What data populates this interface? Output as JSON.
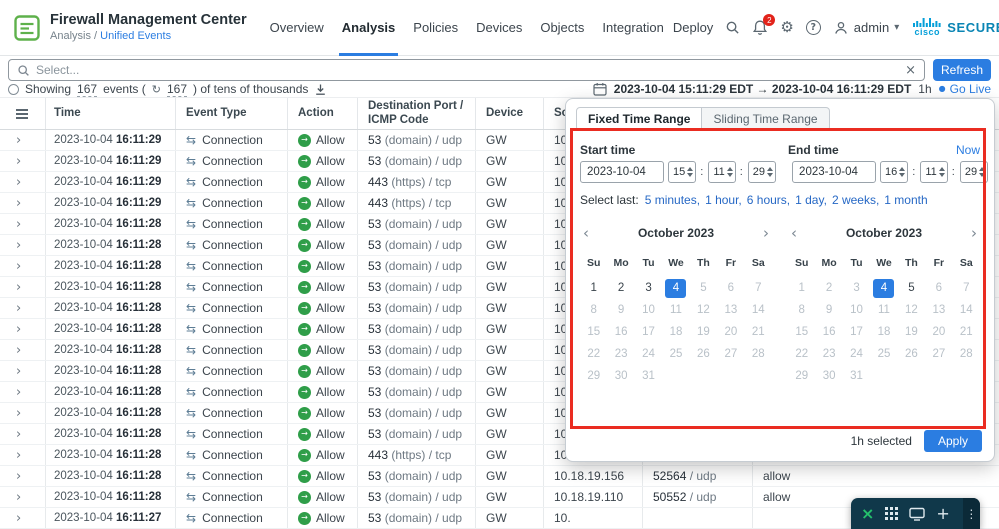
{
  "header": {
    "product": "Firewall Management Center",
    "breadcrumb": {
      "section": "Analysis /",
      "page": "Unified Events"
    },
    "nav": [
      {
        "label": "Overview",
        "active": false
      },
      {
        "label": "Analysis",
        "active": true
      },
      {
        "label": "Policies",
        "active": false
      },
      {
        "label": "Devices",
        "active": false
      },
      {
        "label": "Objects",
        "active": false
      },
      {
        "label": "Integration",
        "active": false
      }
    ],
    "deploy": "Deploy",
    "badge_count": "2",
    "user": "admin",
    "brand": {
      "cisco": "cisco",
      "secure": "SECURE"
    }
  },
  "filter": {
    "placeholder": "Select...",
    "refresh": "Refresh"
  },
  "status": {
    "prefix": "Showing",
    "total": "167",
    "mid": "events (",
    "refreshed": "167",
    "suffix": ") of tens of thousands",
    "range": "2023-10-04 15:11:29 EDT → 2023-10-04 16:11:29 EDT",
    "duration": "1h",
    "go_live": "Go Live"
  },
  "table": {
    "columns": [
      "Time",
      "Event Type",
      "Action",
      "Destination Port / ICMP Code",
      "Device",
      "Source",
      "",
      ""
    ],
    "rows": [
      {
        "date": "2023-10-04",
        "time": "16:11:29",
        "type": "Connection",
        "action": "Allow",
        "dest": "53 (domain) / udp",
        "device": "GW",
        "source": "10.",
        "sport": "",
        "rule": ""
      },
      {
        "date": "2023-10-04",
        "time": "16:11:29",
        "type": "Connection",
        "action": "Allow",
        "dest": "53 (domain) / udp",
        "device": "GW",
        "source": "10.",
        "sport": "",
        "rule": ""
      },
      {
        "date": "2023-10-04",
        "time": "16:11:29",
        "type": "Connection",
        "action": "Allow",
        "dest": "443 (https) / tcp",
        "device": "GW",
        "source": "10.",
        "sport": "",
        "rule": ""
      },
      {
        "date": "2023-10-04",
        "time": "16:11:29",
        "type": "Connection",
        "action": "Allow",
        "dest": "443 (https) / tcp",
        "device": "GW",
        "source": "10.",
        "sport": "",
        "rule": ""
      },
      {
        "date": "2023-10-04",
        "time": "16:11:28",
        "type": "Connection",
        "action": "Allow",
        "dest": "53 (domain) / udp",
        "device": "GW",
        "source": "10.",
        "sport": "",
        "rule": ""
      },
      {
        "date": "2023-10-04",
        "time": "16:11:28",
        "type": "Connection",
        "action": "Allow",
        "dest": "53 (domain) / udp",
        "device": "GW",
        "source": "10.",
        "sport": "",
        "rule": ""
      },
      {
        "date": "2023-10-04",
        "time": "16:11:28",
        "type": "Connection",
        "action": "Allow",
        "dest": "53 (domain) / udp",
        "device": "GW",
        "source": "10.",
        "sport": "",
        "rule": ""
      },
      {
        "date": "2023-10-04",
        "time": "16:11:28",
        "type": "Connection",
        "action": "Allow",
        "dest": "53 (domain) / udp",
        "device": "GW",
        "source": "10.",
        "sport": "",
        "rule": ""
      },
      {
        "date": "2023-10-04",
        "time": "16:11:28",
        "type": "Connection",
        "action": "Allow",
        "dest": "53 (domain) / udp",
        "device": "GW",
        "source": "10.",
        "sport": "",
        "rule": ""
      },
      {
        "date": "2023-10-04",
        "time": "16:11:28",
        "type": "Connection",
        "action": "Allow",
        "dest": "53 (domain) / udp",
        "device": "GW",
        "source": "10.",
        "sport": "",
        "rule": ""
      },
      {
        "date": "2023-10-04",
        "time": "16:11:28",
        "type": "Connection",
        "action": "Allow",
        "dest": "53 (domain) / udp",
        "device": "GW",
        "source": "10.",
        "sport": "",
        "rule": ""
      },
      {
        "date": "2023-10-04",
        "time": "16:11:28",
        "type": "Connection",
        "action": "Allow",
        "dest": "53 (domain) / udp",
        "device": "GW",
        "source": "10.",
        "sport": "",
        "rule": ""
      },
      {
        "date": "2023-10-04",
        "time": "16:11:28",
        "type": "Connection",
        "action": "Allow",
        "dest": "53 (domain) / udp",
        "device": "GW",
        "source": "10.",
        "sport": "",
        "rule": ""
      },
      {
        "date": "2023-10-04",
        "time": "16:11:28",
        "type": "Connection",
        "action": "Allow",
        "dest": "53 (domain) / udp",
        "device": "GW",
        "source": "10.",
        "sport": "",
        "rule": ""
      },
      {
        "date": "2023-10-04",
        "time": "16:11:28",
        "type": "Connection",
        "action": "Allow",
        "dest": "53 (domain) / udp",
        "device": "GW",
        "source": "10.",
        "sport": "",
        "rule": ""
      },
      {
        "date": "2023-10-04",
        "time": "16:11:28",
        "type": "Connection",
        "action": "Allow",
        "dest": "443 (https) / tcp",
        "device": "GW",
        "source": "10.",
        "sport": "",
        "rule": ""
      },
      {
        "date": "2023-10-04",
        "time": "16:11:28",
        "type": "Connection",
        "action": "Allow",
        "dest": "53 (domain) / udp",
        "device": "GW",
        "source": "10.18.19.156",
        "sport": "52564 / udp",
        "rule": "allow"
      },
      {
        "date": "2023-10-04",
        "time": "16:11:28",
        "type": "Connection",
        "action": "Allow",
        "dest": "53 (domain) / udp",
        "device": "GW",
        "source": "10.18.19.110",
        "sport": "50552 / udp",
        "rule": "allow"
      },
      {
        "date": "2023-10-04",
        "time": "16:11:27",
        "type": "Connection",
        "action": "Allow",
        "dest": "53 (domain) / udp",
        "device": "GW",
        "source": "10.",
        "sport": "",
        "rule": ""
      }
    ]
  },
  "time_popup": {
    "tabs": [
      {
        "label": "Fixed Time Range",
        "active": true
      },
      {
        "label": "Sliding Time Range",
        "active": false
      }
    ],
    "start_label": "Start time",
    "end_label": "End time",
    "now_link": "Now",
    "start_date": "2023-10-04",
    "start_h": "15",
    "start_m": "11",
    "start_s": "29",
    "end_date": "2023-10-04",
    "end_h": "16",
    "end_m": "11",
    "end_s": "29",
    "select_last": "Select last:",
    "presets": [
      "5 minutes",
      "1 hour",
      "6 hours",
      "1 day",
      "2 weeks",
      "1 month"
    ],
    "calendar_left": {
      "month": "October 2023",
      "weekdays": [
        "Su",
        "Mo",
        "Tu",
        "We",
        "Th",
        "Fr",
        "Sa"
      ],
      "days_in_month": 31,
      "selected_day": 4,
      "active_days": [
        1,
        2,
        3
      ]
    },
    "calendar_right": {
      "month": "October 2023",
      "weekdays": [
        "Su",
        "Mo",
        "Tu",
        "We",
        "Th",
        "Fr",
        "Sa"
      ],
      "days_in_month": 31,
      "selected_day": 4,
      "active_days": [
        5
      ]
    },
    "selected_summary": "1h selected",
    "apply": "Apply"
  },
  "icons": {
    "clear": "×",
    "gear": "⚙",
    "help": "?",
    "caret_down": "▾",
    "row_expand": "›",
    "connection": "⇆",
    "allow_arrow": "→",
    "refresh_inline": "↻",
    "live_dot": "●",
    "cal_prev": "‹",
    "cal_next": "›",
    "close": "×",
    "plus": "+",
    "more": "⋮"
  },
  "annotation_color": "#ea2c21",
  "accent_color": "#2b7de1"
}
